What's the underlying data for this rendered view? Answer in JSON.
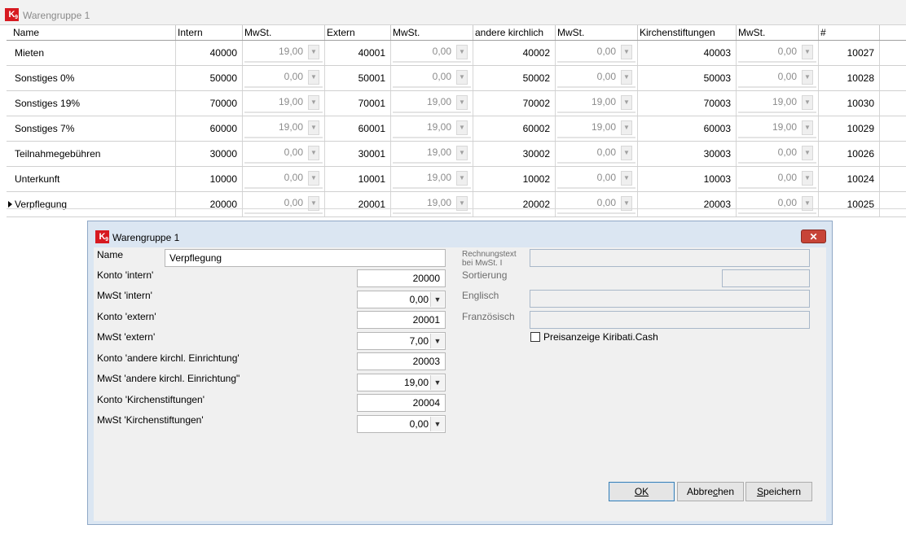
{
  "app": {
    "window_title": "Warengruppe 1",
    "logo_text": "K",
    "logo_sub": "9"
  },
  "grid": {
    "columns": [
      "Name",
      "Intern",
      "MwSt.",
      "Extern",
      "MwSt.",
      "andere kirchlich",
      "MwSt.",
      "Kirchenstiftungen",
      "MwSt.",
      "#"
    ],
    "rows": [
      {
        "name": "Mieten",
        "intern": "40000",
        "mw1": "19,00",
        "extern": "40001",
        "mw2": "0,00",
        "andere": "40002",
        "mw3": "0,00",
        "kirchen": "40003",
        "mw4": "0,00",
        "id": "10027"
      },
      {
        "name": "Sonstiges 0%",
        "intern": "50000",
        "mw1": "0,00",
        "extern": "50001",
        "mw2": "0,00",
        "andere": "50002",
        "mw3": "0,00",
        "kirchen": "50003",
        "mw4": "0,00",
        "id": "10028"
      },
      {
        "name": "Sonstiges 19%",
        "intern": "70000",
        "mw1": "19,00",
        "extern": "70001",
        "mw2": "19,00",
        "andere": "70002",
        "mw3": "19,00",
        "kirchen": "70003",
        "mw4": "19,00",
        "id": "10030"
      },
      {
        "name": "Sonstiges 7%",
        "intern": "60000",
        "mw1": "19,00",
        "extern": "60001",
        "mw2": "19,00",
        "andere": "60002",
        "mw3": "19,00",
        "kirchen": "60003",
        "mw4": "19,00",
        "id": "10029"
      },
      {
        "name": "Teilnahmegebühren",
        "intern": "30000",
        "mw1": "0,00",
        "extern": "30001",
        "mw2": "19,00",
        "andere": "30002",
        "mw3": "0,00",
        "kirchen": "30003",
        "mw4": "0,00",
        "id": "10026"
      },
      {
        "name": "Unterkunft",
        "intern": "10000",
        "mw1": "0,00",
        "extern": "10001",
        "mw2": "19,00",
        "andere": "10002",
        "mw3": "0,00",
        "kirchen": "10003",
        "mw4": "0,00",
        "id": "10024"
      },
      {
        "name": "Verpflegung",
        "intern": "20000",
        "mw1": "0,00",
        "extern": "20001",
        "mw2": "19,00",
        "andere": "20002",
        "mw3": "0,00",
        "kirchen": "20003",
        "mw4": "0,00",
        "id": "10025",
        "current": true
      }
    ]
  },
  "dialog": {
    "title": "Warengruppe 1",
    "close_glyph": "✕",
    "name_label": "Name",
    "name_value": "Verpflegung",
    "konto_intern_label": "Konto 'intern'",
    "konto_intern_value": "20000",
    "mwst_intern_label": "MwSt 'intern'",
    "mwst_intern_value": "0,00",
    "konto_extern_label": "Konto 'extern'",
    "konto_extern_value": "20001",
    "mwst_extern_label": "MwSt 'extern'",
    "mwst_extern_value": "7,00",
    "konto_andere_label": "Konto 'andere kirchl. Einrichtung'",
    "konto_andere_value": "20003",
    "mwst_andere_label": "MwSt 'andere kirchl. Einrichtung\"",
    "mwst_andere_value": "19,00",
    "konto_kirchen_label": "Konto 'Kirchenstiftungen'",
    "konto_kirchen_value": "20004",
    "mwst_kirchen_label": "MwSt 'Kirchenstiftungen'",
    "mwst_kirchen_value": "0,00",
    "rechnungstext_label_1": "Rechnungstext",
    "rechnungstext_label_2": "bei MwSt. I",
    "sortierung_label": "Sortierung",
    "englisch_label": "Englisch",
    "franzoesisch_label": "Französisch",
    "preisanzeige_label": "Preisanzeige Kiribati.Cash",
    "ok_label": "OK",
    "abbrechen_pre": "Abbre",
    "abbrechen_u": "c",
    "abbrechen_post": "hen",
    "speichern_u": "S",
    "speichern_post": "peichern"
  }
}
